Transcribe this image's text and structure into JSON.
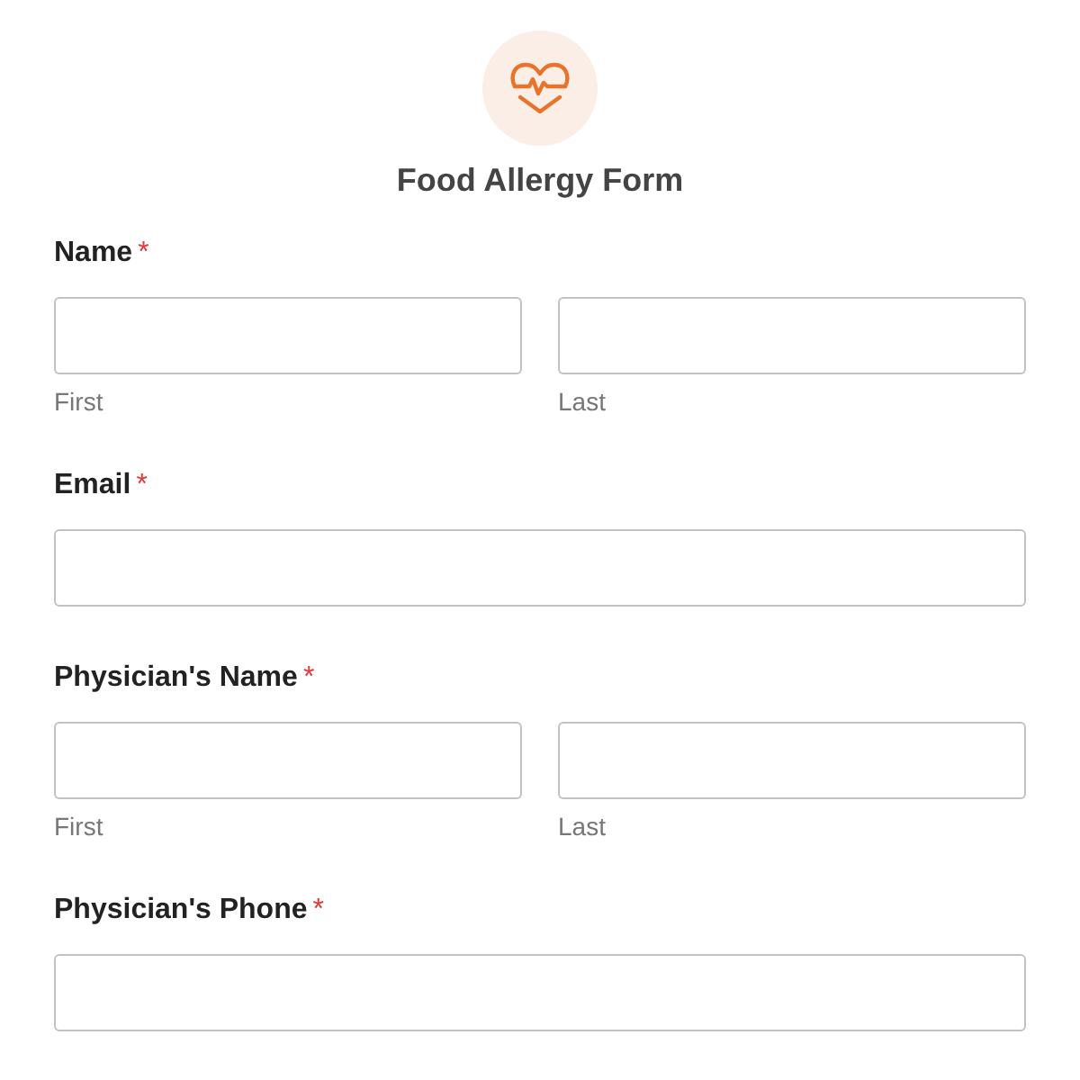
{
  "form": {
    "title": "Food Allergy Form"
  },
  "fields": [
    {
      "kind": "name",
      "label": "Name",
      "required_mark": "*",
      "sublabels": [
        "First",
        "Last"
      ]
    },
    {
      "kind": "single",
      "label": "Email",
      "required_mark": "*"
    },
    {
      "kind": "name",
      "label": "Physician's Name",
      "required_mark": "*",
      "sublabels": [
        "First",
        "Last"
      ]
    },
    {
      "kind": "single",
      "label": "Physician's Phone",
      "required_mark": "*"
    }
  ]
}
